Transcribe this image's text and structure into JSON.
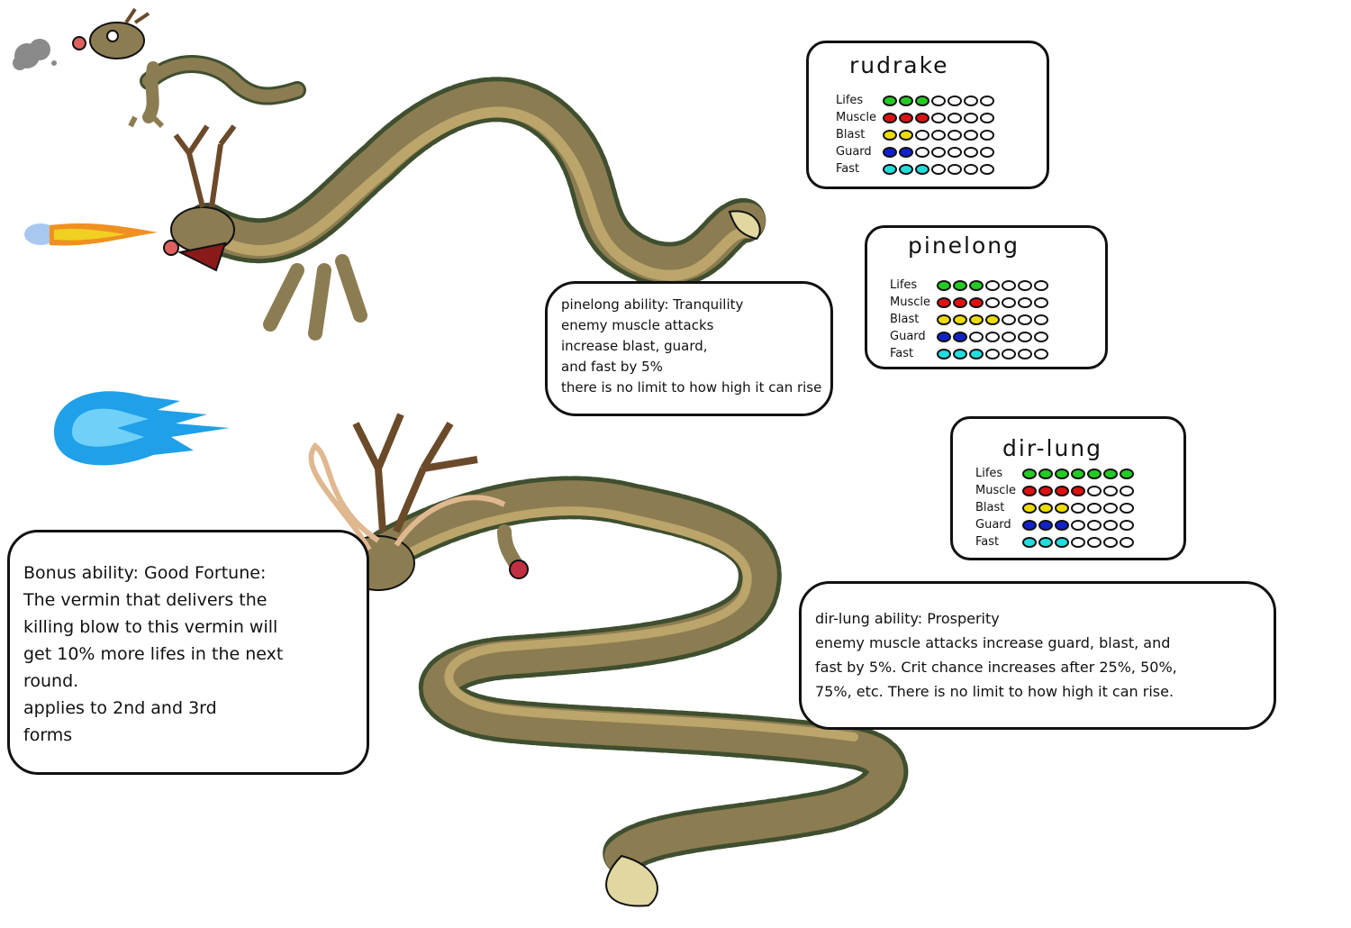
{
  "colors": {
    "lifes": "#22cc22",
    "muscle": "#dd1111",
    "blast": "#eedd00",
    "guard": "#1122cc",
    "fast": "#22dddd",
    "body": "#8c7c52",
    "belly": "#bba56a",
    "spine": "#3f4f2f",
    "antler": "#6b4a2a"
  },
  "stat_max": 7,
  "cards": [
    {
      "title": "rudrake",
      "stats": [
        {
          "label": "Lifes",
          "key": "lifes",
          "filled": 3
        },
        {
          "label": "Muscle",
          "key": "muscle",
          "filled": 3
        },
        {
          "label": "Blast",
          "key": "blast",
          "filled": 2
        },
        {
          "label": "Guard",
          "key": "guard",
          "filled": 2
        },
        {
          "label": "Fast",
          "key": "fast",
          "filled": 3
        }
      ]
    },
    {
      "title": "pinelong",
      "stats": [
        {
          "label": "Lifes",
          "key": "lifes",
          "filled": 3
        },
        {
          "label": "Muscle",
          "key": "muscle",
          "filled": 3
        },
        {
          "label": "Blast",
          "key": "blast",
          "filled": 4
        },
        {
          "label": "Guard",
          "key": "guard",
          "filled": 2
        },
        {
          "label": "Fast",
          "key": "fast",
          "filled": 3
        }
      ]
    },
    {
      "title": "dir-lung",
      "stats": [
        {
          "label": "Lifes",
          "key": "lifes",
          "filled": 7
        },
        {
          "label": "Muscle",
          "key": "muscle",
          "filled": 4
        },
        {
          "label": "Blast",
          "key": "blast",
          "filled": 3
        },
        {
          "label": "Guard",
          "key": "guard",
          "filled": 3
        },
        {
          "label": "Fast",
          "key": "fast",
          "filled": 3
        }
      ]
    }
  ],
  "pinelong_ability": "pinelong ability: Tranquility\nenemy muscle attacks\nincrease blast, guard,\nand fast by 5%\nthere is no limit to how high it can rise",
  "dirlung_ability": "dir-lung ability: Prosperity\nenemy muscle attacks increase guard, blast, and\nfast by 5%. Crit chance increases after 25%, 50%,\n75%, etc. There is no limit to how high it can rise.",
  "bonus_ability": "Bonus ability: Good Fortune:\nThe vermin that delivers the\nkilling blow to this vermin will\nget 10% more lifes in the next\nround.\n    applies to 2nd and 3rd\n    forms"
}
